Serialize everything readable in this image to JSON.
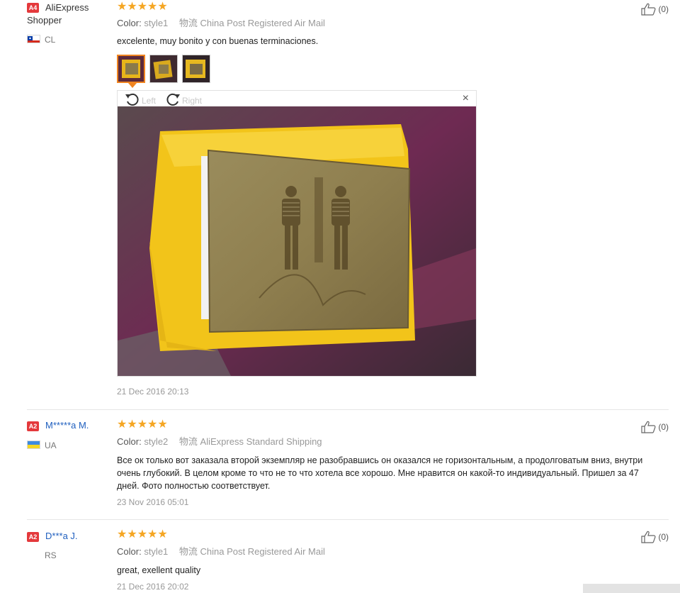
{
  "reviews": [
    {
      "badge": "A4",
      "user": "AliExpress Shopper",
      "country": "CL",
      "rating_stars": "★★★★★",
      "rating": 5,
      "color_label": "Color:",
      "color_value": "style1",
      "shipping_label": "物流",
      "shipping_value": "China Post Registered Air Mail",
      "text": "excelente, muy bonito y con buenas terminaciones.",
      "date": "21 Dec 2016 20:13",
      "helpful": "(0)",
      "viewer": {
        "rotate_left": "Left",
        "rotate_right": "Right",
        "close": "×"
      }
    },
    {
      "badge": "A2",
      "user": "M*****a M.",
      "country": "UA",
      "rating_stars": "★★★★★",
      "rating": 5,
      "color_label": "Color:",
      "color_value": "style2",
      "shipping_label": "物流",
      "shipping_value": "AliExpress Standard Shipping",
      "text": "Все ок только вот заказала второй экземпляр не разобравшись он оказался не горизонтальным, а продолговатым вниз, внутри очень глубокий. В целом кроме то что не то что хотела все хорошо. Мне нравится он какой-то индивидуальный. Пришел за 47 дней. Фото полностью соответствует.",
      "date": "23 Nov 2016 05:01",
      "helpful": "(0)"
    },
    {
      "badge": "A2",
      "user": "D***a J.",
      "country": "RS",
      "rating_stars": "★★★★★",
      "rating": 5,
      "color_label": "Color:",
      "color_value": "style1",
      "shipping_label": "物流",
      "shipping_value": "China Post Registered Air Mail",
      "text": "great, exellent quality",
      "date": "21 Dec 2016 20:02",
      "helpful": "(0)"
    }
  ],
  "colors": {
    "star": "#f5a623",
    "badge": "#e4393c",
    "link": "#1f5fbf",
    "thumb_active": "#f08420"
  },
  "icons": [
    "thumbs-up-icon",
    "rotate-left-icon",
    "rotate-right-icon",
    "close-icon",
    "chile-flag-icon",
    "ukraine-flag-icon"
  ]
}
